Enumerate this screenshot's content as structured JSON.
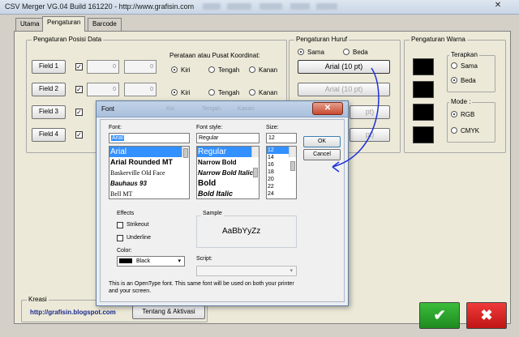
{
  "window": {
    "title": "CSV Merger VG.04 Build 161220 - http://www.grafisin.com",
    "close_glyph": "✕"
  },
  "tabs": [
    {
      "label": "Utama"
    },
    {
      "label": "Pengaturan"
    },
    {
      "label": "Barcode"
    }
  ],
  "posisi": {
    "legend": "Pengaturan Posisi Data",
    "fields": [
      {
        "label": "Field 1",
        "x": "0",
        "y": "0"
      },
      {
        "label": "Field 2",
        "x": "0",
        "y": "0"
      },
      {
        "label": "Field 3"
      },
      {
        "label": "Field 4"
      }
    ],
    "check_glyph": "✓",
    "alignment_label": "Perataan atau Pusat Koordinat:",
    "align_options": [
      "Kiri",
      "Tengah",
      "Kanan"
    ]
  },
  "huruf": {
    "legend": "Pengaturan Huruf",
    "options": [
      "Sama",
      "Beda"
    ],
    "font_button": "Arial (10 pt)",
    "font_button_2": "Arial (10 pt)",
    "partial_pt": "pt)"
  },
  "warna": {
    "legend": "Pengaturan Warna",
    "terapkan": "Terapkan",
    "terapkan_opts": [
      "Sama",
      "Beda"
    ],
    "mode": "Mode :",
    "mode_opts": [
      "RGB",
      "CMYK"
    ],
    "swatch_color": "#000000"
  },
  "kreasi": {
    "legend": "Kreasi",
    "link": "http://grafisin.blogspot.com",
    "about_button": "Tentang & Aktivasi"
  },
  "actions": {
    "ok_glyph": "✔",
    "cancel_glyph": "✖",
    "ok_color": "#2a9d2a",
    "cancel_color": "#d62020"
  },
  "font_dialog": {
    "title": "Font",
    "close_glyph": "✕",
    "font_label": "Font:",
    "font_value": "Arial",
    "fonts": [
      "Arial",
      "Arial Rounded MT",
      "Baskerville Old Face",
      "Bauhaus 93",
      "Bell MT"
    ],
    "style_label": "Font style:",
    "style_value": "Regular",
    "styles": [
      "Regular",
      "Narrow Bold",
      "Narrow Bold Italic",
      "Bold",
      "Bold Italic"
    ],
    "size_label": "Size:",
    "size_value": "12",
    "sizes": [
      "12",
      "14",
      "16",
      "18",
      "20",
      "22",
      "24"
    ],
    "ok": "OK",
    "cancel": "Cancel",
    "effects_label": "Effects",
    "strikeout": "Strikeout",
    "underline": "Underline",
    "color_label": "Color:",
    "color_value": "Black",
    "sample_label": "Sample",
    "sample_text": "AaBbYyZz",
    "script_label": "Script:",
    "note": "This is an OpenType font. This same font will be used on both your printer and your screen.",
    "ghost_radios": [
      "Kiri",
      "Tengah",
      "Kanan"
    ]
  }
}
